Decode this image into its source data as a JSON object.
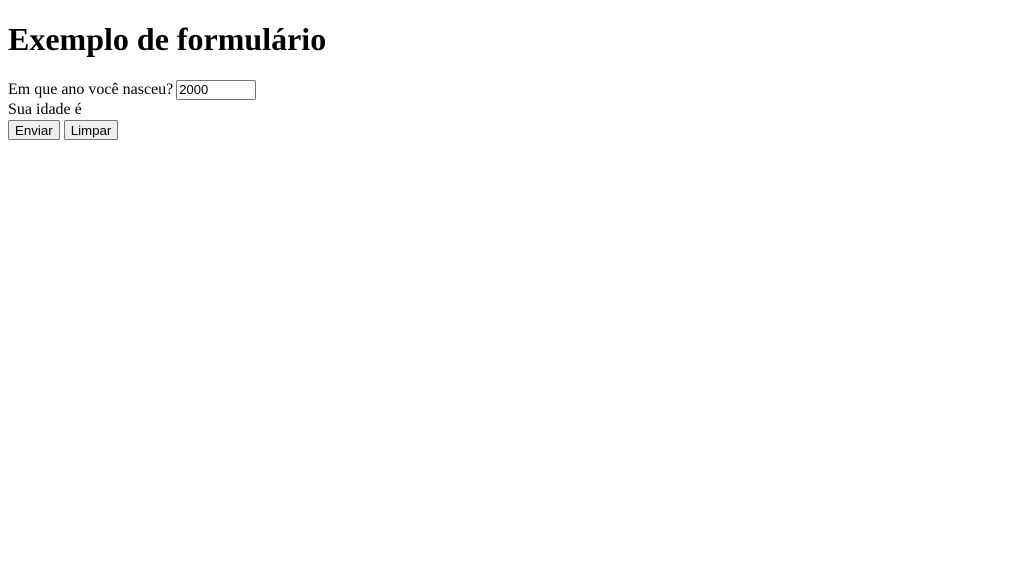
{
  "page": {
    "title": "Exemplo de formulário"
  },
  "form": {
    "question_label": "Em que ano você nasceu?",
    "year_value": "2000",
    "age_text": "Sua idade é",
    "submit_label": "Enviar",
    "reset_label": "Limpar"
  }
}
